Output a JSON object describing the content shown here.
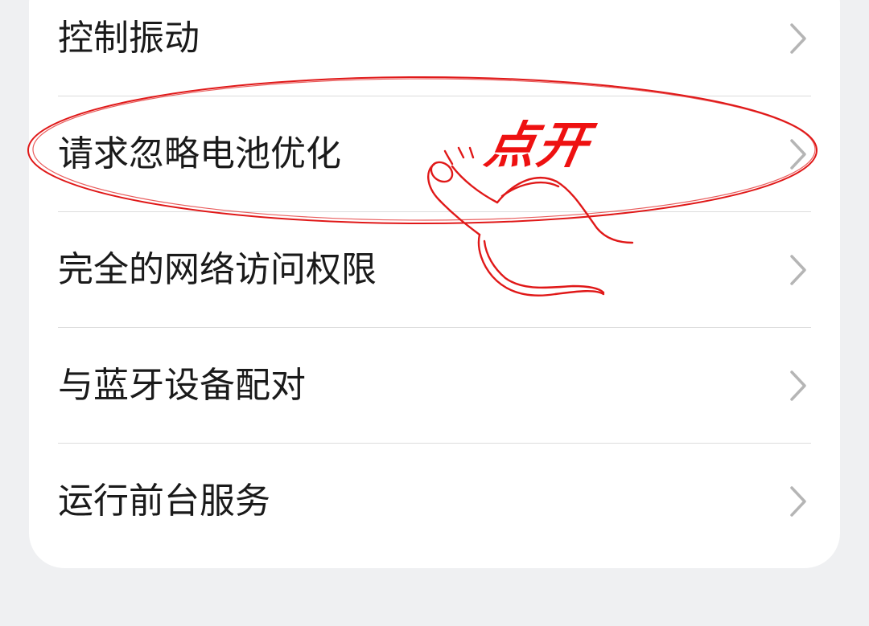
{
  "settings_list": {
    "items": [
      {
        "label": "控制振动"
      },
      {
        "label": "请求忽略电池优化"
      },
      {
        "label": "完全的网络访问权限"
      },
      {
        "label": "与蓝牙设备配对"
      },
      {
        "label": "运行前台服务"
      }
    ]
  },
  "annotation": {
    "text": "点开",
    "color": "#ee1111"
  },
  "icons": {
    "row_chevron": "chevron-right-icon",
    "annotation_hand": "tap-hand-icon"
  }
}
